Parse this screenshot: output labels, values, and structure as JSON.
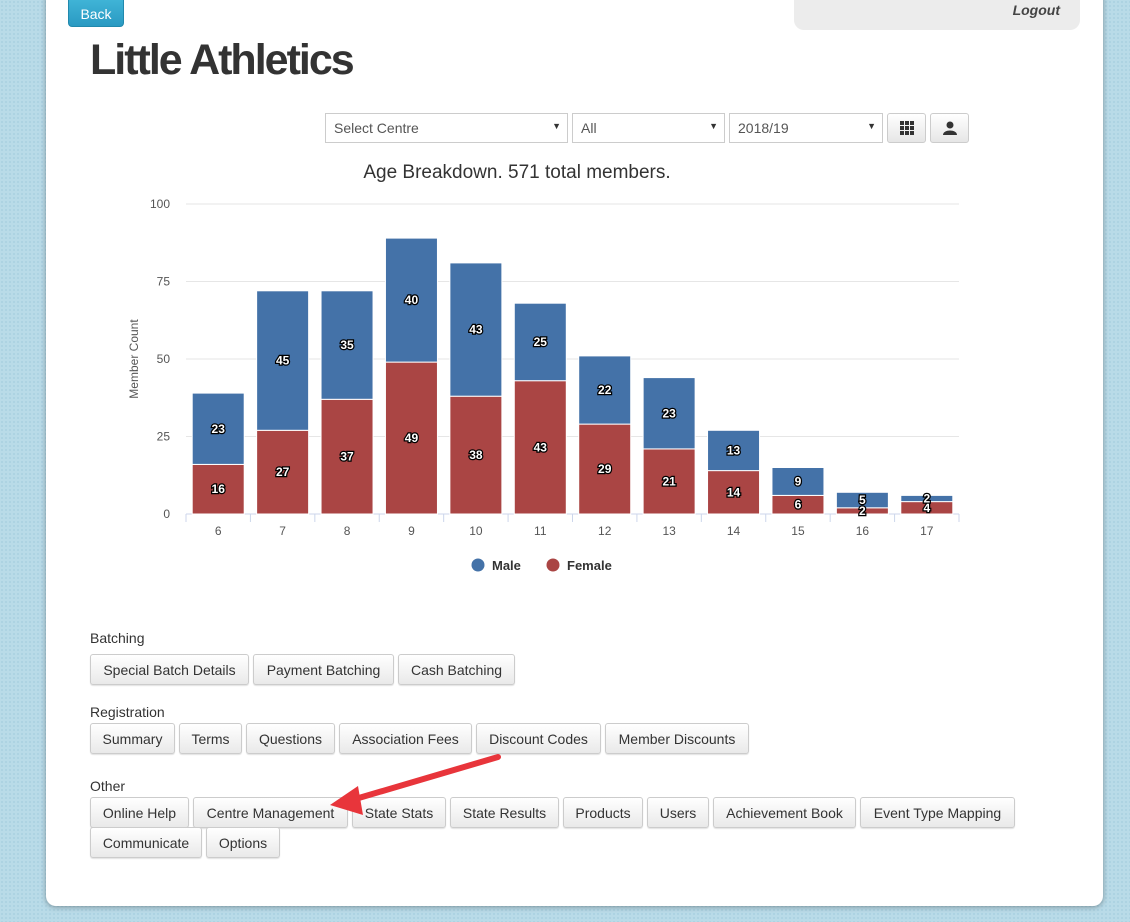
{
  "header": {
    "back_label": "Back",
    "logout_label": "Logout",
    "title": "Little Athletics"
  },
  "filters": {
    "centre": "Select Centre",
    "type": "All",
    "season": "2018/19",
    "grid_icon": "grid-icon",
    "person_icon": "person-icon"
  },
  "chart_data": {
    "type": "bar",
    "stacked": true,
    "title": "Age Breakdown. 571 total members.",
    "ylabel": "Member Count",
    "xlabel": "",
    "ylim": [
      0,
      100
    ],
    "yticks": [
      0,
      25,
      50,
      75,
      100
    ],
    "categories": [
      "6",
      "7",
      "8",
      "9",
      "10",
      "11",
      "12",
      "13",
      "14",
      "15",
      "16",
      "17"
    ],
    "series": [
      {
        "name": "Male",
        "color": "#4472a8",
        "values": [
          23,
          45,
          35,
          40,
          43,
          25,
          22,
          23,
          13,
          9,
          5,
          2
        ]
      },
      {
        "name": "Female",
        "color": "#aa4544",
        "values": [
          16,
          27,
          37,
          49,
          38,
          43,
          29,
          21,
          14,
          6,
          2,
          4
        ]
      }
    ],
    "legend": "bottom",
    "grid": true
  },
  "sections": {
    "batching": {
      "label": "Batching",
      "buttons": [
        "Special Batch Details",
        "Payment Batching",
        "Cash Batching"
      ]
    },
    "registration": {
      "label": "Registration",
      "buttons": [
        "Summary",
        "Terms",
        "Questions",
        "Association Fees",
        "Discount Codes",
        "Member Discounts"
      ]
    },
    "other": {
      "label": "Other",
      "buttons": [
        "Online Help",
        "Centre Management",
        "State Stats",
        "State Results",
        "Products",
        "Users",
        "Achievement Book",
        "Event Type Mapping",
        "Communicate",
        "Options"
      ]
    }
  },
  "annotation": {
    "arrow_color": "#e8353b"
  }
}
